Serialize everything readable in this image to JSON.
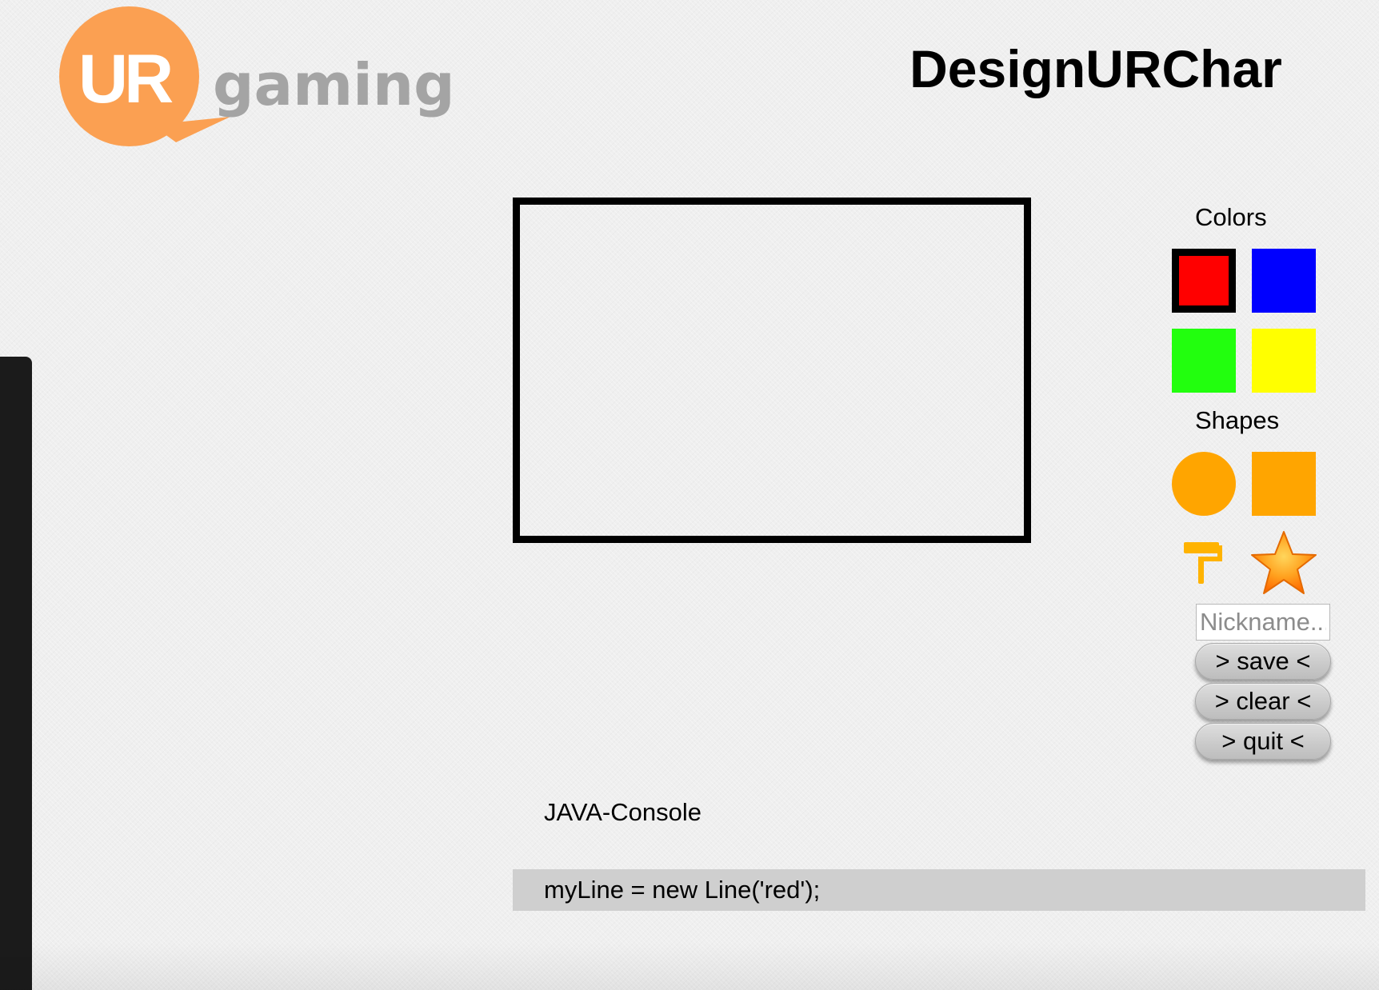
{
  "logo": {
    "mark_text": "UR",
    "word_text": "gaming",
    "bubble_color": "#fba052",
    "word_color": "#a4a4a4"
  },
  "header": {
    "title": "DesignURChar"
  },
  "palette": {
    "colors_heading": "Colors",
    "shapes_heading": "Shapes",
    "selected_color": "red",
    "colors": [
      {
        "name": "red",
        "hex": "#ff0000"
      },
      {
        "name": "blue",
        "hex": "#0000ff"
      },
      {
        "name": "green",
        "hex": "#22ff0e"
      },
      {
        "name": "yellow",
        "hex": "#ffff00"
      }
    ],
    "shapes": [
      {
        "name": "circle",
        "hex": "#ffa500"
      },
      {
        "name": "square",
        "hex": "#ffa500"
      }
    ],
    "tools": [
      {
        "icon": "paint-roller-icon"
      },
      {
        "icon": "star-icon"
      }
    ]
  },
  "form": {
    "nickname_placeholder": "Nickname...",
    "nickname_value": "",
    "save_label": "> save <",
    "clear_label": "> clear <",
    "quit_label": "> quit <"
  },
  "console": {
    "label": "JAVA-Console",
    "line": "myLine = new Line('red');"
  },
  "colors": {
    "background": "#efefef",
    "sidebar": "#1b1b1b",
    "console_bg": "#cfcfcf",
    "accent_orange": "#ffa500"
  }
}
